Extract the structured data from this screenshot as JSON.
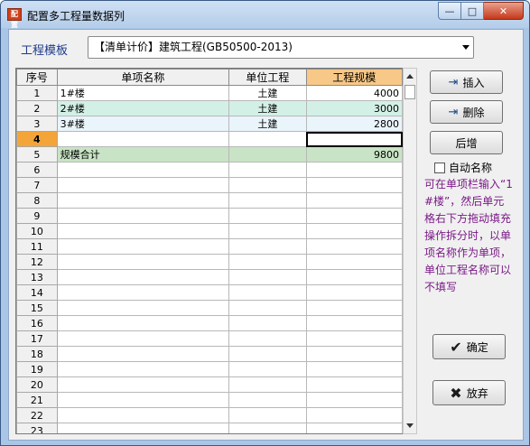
{
  "window": {
    "icon_text": "配置",
    "title": "配置多工程量数据列",
    "controls": {
      "min": "—",
      "max": "□",
      "close": "✕"
    }
  },
  "template": {
    "label": "工程模板",
    "selected": "【清单计价】建筑工程(GB50500-2013)"
  },
  "grid": {
    "headers": [
      "序号",
      "单项名称",
      "单位工程",
      "工程规模"
    ],
    "rows": [
      {
        "no": "1",
        "name": "1#楼",
        "unit": "土建",
        "scale": "4000"
      },
      {
        "no": "2",
        "name": "2#楼",
        "unit": "土建",
        "scale": "3000"
      },
      {
        "no": "3",
        "name": "3#楼",
        "unit": "土建",
        "scale": "2800"
      },
      {
        "no": "4",
        "name": "",
        "unit": "",
        "scale": ""
      },
      {
        "no": "5",
        "name": "规模合计",
        "unit": "",
        "scale": "9800"
      },
      {
        "no": "6",
        "name": "",
        "unit": "",
        "scale": ""
      },
      {
        "no": "7",
        "name": "",
        "unit": "",
        "scale": ""
      },
      {
        "no": "8",
        "name": "",
        "unit": "",
        "scale": ""
      },
      {
        "no": "9",
        "name": "",
        "unit": "",
        "scale": ""
      },
      {
        "no": "10",
        "name": "",
        "unit": "",
        "scale": ""
      },
      {
        "no": "11",
        "name": "",
        "unit": "",
        "scale": ""
      },
      {
        "no": "12",
        "name": "",
        "unit": "",
        "scale": ""
      },
      {
        "no": "13",
        "name": "",
        "unit": "",
        "scale": ""
      },
      {
        "no": "14",
        "name": "",
        "unit": "",
        "scale": ""
      },
      {
        "no": "15",
        "name": "",
        "unit": "",
        "scale": ""
      },
      {
        "no": "16",
        "name": "",
        "unit": "",
        "scale": ""
      },
      {
        "no": "17",
        "name": "",
        "unit": "",
        "scale": ""
      },
      {
        "no": "18",
        "name": "",
        "unit": "",
        "scale": ""
      },
      {
        "no": "19",
        "name": "",
        "unit": "",
        "scale": ""
      },
      {
        "no": "20",
        "name": "",
        "unit": "",
        "scale": ""
      },
      {
        "no": "21",
        "name": "",
        "unit": "",
        "scale": ""
      },
      {
        "no": "22",
        "name": "",
        "unit": "",
        "scale": ""
      },
      {
        "no": "23",
        "name": "",
        "unit": "",
        "scale": ""
      }
    ]
  },
  "buttons": {
    "insert": "插入",
    "delete": "删除",
    "next": "后增",
    "ok": "确定",
    "cancel": "放弃"
  },
  "auto_name": {
    "label": "自动名称",
    "checked": false
  },
  "hint": "可在单项栏输入“1#楼”，然后单元格右下方拖动填充操作拆分时，以单项名称作为单项，单位工程名称可以不填写",
  "colors": {
    "hint_text": "#7a1a86",
    "header_highlight": "#f7c887",
    "selected_row_marker": "#f3a53a",
    "total_row": "#c8e3c5"
  }
}
